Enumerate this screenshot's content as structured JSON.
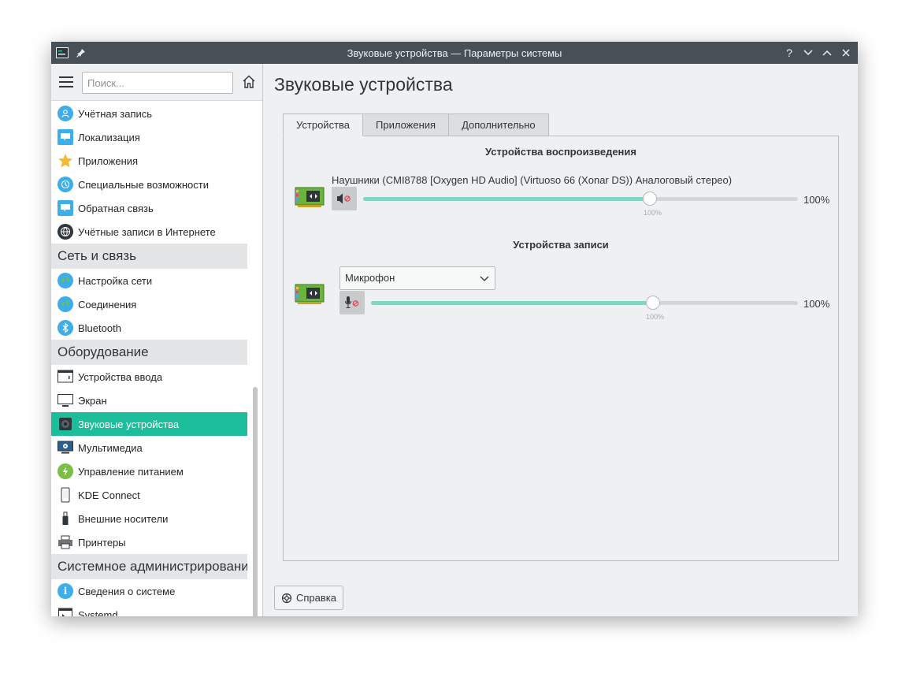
{
  "window": {
    "title": "Звуковые устройства — Параметры системы",
    "titlebar_buttons": [
      "help-icon",
      "minimize-icon",
      "maximize-icon",
      "close-icon"
    ]
  },
  "sidebar": {
    "search_placeholder": "Поиск...",
    "items_top": [
      {
        "label": "Учётная запись",
        "icon": "user-icon",
        "color": "#3daee9"
      },
      {
        "label": "Локализация",
        "icon": "locale-icon",
        "color": "#3daee9"
      },
      {
        "label": "Приложения",
        "icon": "star-icon",
        "color": "#f5b932"
      },
      {
        "label": "Специальные возможности",
        "icon": "accessibility-icon",
        "color": "#3daee9"
      },
      {
        "label": "Обратная связь",
        "icon": "feedback-icon",
        "color": "#3daee9"
      },
      {
        "label": "Учётные записи в Интернете",
        "icon": "globe-icon",
        "color": "#31363b"
      }
    ],
    "section_network": "Сеть и связь",
    "items_network": [
      {
        "label": "Настройка сети",
        "icon": "network-icon",
        "color": "#3daee9"
      },
      {
        "label": "Соединения",
        "icon": "connections-icon",
        "color": "#3daee9"
      },
      {
        "label": "Bluetooth",
        "icon": "bluetooth-icon",
        "color": "#3daee9"
      }
    ],
    "section_hardware": "Оборудование",
    "items_hardware": [
      {
        "label": "Устройства ввода",
        "icon": "input-devices-icon",
        "color": "#31363b"
      },
      {
        "label": "Экран",
        "icon": "display-icon",
        "color": "#31363b"
      },
      {
        "label": "Звуковые устройства",
        "icon": "speaker-icon",
        "color": "#31363b",
        "active": true
      },
      {
        "label": "Мультимедиа",
        "icon": "multimedia-icon",
        "color": "#31363b"
      },
      {
        "label": "Управление питанием",
        "icon": "power-icon",
        "color": "#7bc043"
      },
      {
        "label": "KDE Connect",
        "icon": "phone-icon",
        "color": "#31363b"
      },
      {
        "label": "Внешние носители",
        "icon": "usb-icon",
        "color": "#31363b"
      },
      {
        "label": "Принтеры",
        "icon": "printer-icon",
        "color": "#31363b"
      }
    ],
    "section_admin": "Системное администрировани",
    "items_admin": [
      {
        "label": "Сведения о системе",
        "icon": "info-icon",
        "color": "#3daee9"
      },
      {
        "label": "Systemd",
        "icon": "systemd-icon",
        "color": "#31363b"
      }
    ]
  },
  "content": {
    "page_title": "Звуковые устройства",
    "tabs": [
      "Устройства",
      "Приложения",
      "Дополнительно"
    ],
    "playback": {
      "title": "Устройства воспроизведения",
      "device_name": "Наушники (CMI8788 [Oxygen HD Audio] (Virtuoso 66 (Xonar DS)) Аналоговый стерео)",
      "volume_percent": 100,
      "volume_label": "100%",
      "tick_label": "100%"
    },
    "recording": {
      "title": "Устройства записи",
      "selected_port": "Микрофон",
      "volume_percent": 100,
      "volume_label": "100%",
      "tick_label": "100%"
    },
    "help_label": "Справка"
  },
  "colors": {
    "accent": "#1cbd9a",
    "slider_fill": "#84d6c4",
    "titlebar": "#475057"
  }
}
